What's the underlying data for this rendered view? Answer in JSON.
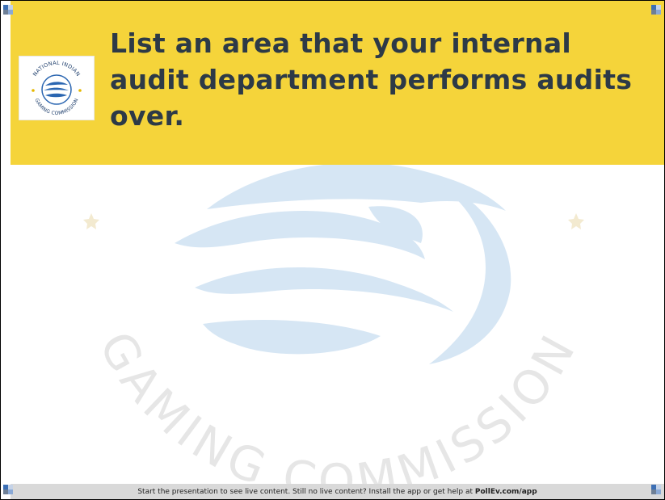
{
  "slide": {
    "question": "List an area that your internal audit department performs audits over.",
    "footer_prefix": "Start the presentation to see live content. Still no live content? Install the app or get help at ",
    "footer_link": "PollEv.com/app"
  },
  "logo": {
    "text_top": "NATIONAL INDIAN",
    "text_bottom": "GAMING COMMISSION"
  },
  "watermark": {
    "text": "GAMING COMMISSION"
  },
  "colors": {
    "header_bg": "#f5d43a",
    "question_text": "#2d3a47",
    "footer_bg": "#d9d9d9",
    "watermark_blue": "#d6e6f4",
    "watermark_text": "#e6e6e6"
  }
}
